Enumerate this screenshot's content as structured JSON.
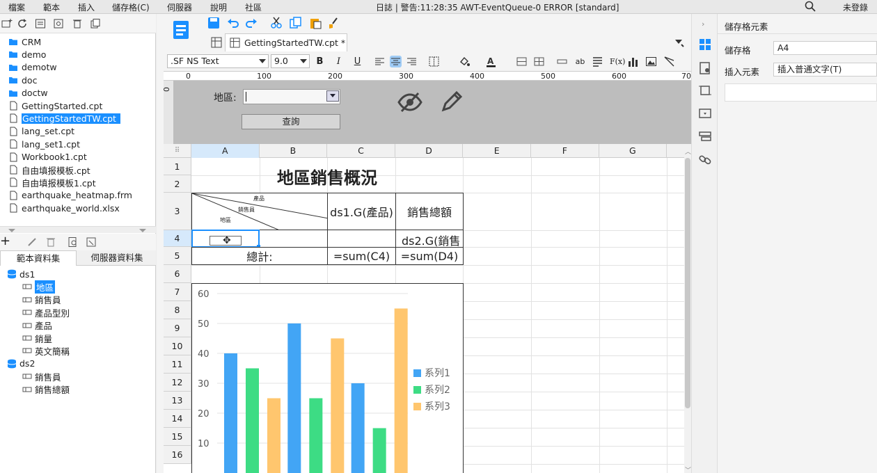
{
  "menubar": {
    "items": [
      "檔案",
      "範本",
      "插入",
      "儲存格(C)",
      "伺服器",
      "說明",
      "社區"
    ],
    "status": "日誌 | 警告:11:28:35 AWT-EventQueue-0 ERROR [standard]",
    "login": "未登錄"
  },
  "file_tree": {
    "items": [
      {
        "label": "CRM",
        "type": "folder"
      },
      {
        "label": "demo",
        "type": "folder"
      },
      {
        "label": "demotw",
        "type": "folder"
      },
      {
        "label": "doc",
        "type": "folder"
      },
      {
        "label": "doctw",
        "type": "folder"
      },
      {
        "label": "GettingStarted.cpt",
        "type": "file"
      },
      {
        "label": "GettingStartedTW.cpt",
        "type": "file",
        "selected": true
      },
      {
        "label": "lang_set.cpt",
        "type": "file"
      },
      {
        "label": "lang_set1.cpt",
        "type": "file"
      },
      {
        "label": "Workbook1.cpt",
        "type": "file"
      },
      {
        "label": "自由填报模板.cpt",
        "type": "file"
      },
      {
        "label": "自由填报模板1.cpt",
        "type": "file"
      },
      {
        "label": "earthquake_heatmap.frm",
        "type": "file"
      },
      {
        "label": "earthquake_world.xlsx",
        "type": "file"
      }
    ]
  },
  "dataset_tabs": [
    "範本資料集",
    "伺服器資料集"
  ],
  "dataset_tree": {
    "ds1": {
      "label": "ds1",
      "fields": [
        "地區",
        "銷售員",
        "產品型別",
        "產品",
        "銷量",
        "英文簡稱"
      ]
    },
    "ds2": {
      "label": "ds2",
      "fields": [
        "銷售員",
        "銷售總額"
      ]
    }
  },
  "editor": {
    "tab_label": "GettingStartedTW.cpt *",
    "font_name": ".SF NS Text",
    "font_size": "9.0",
    "bold": "B",
    "italic": "I",
    "underline": "U",
    "ruler_ticks": [
      "0",
      "100",
      "200",
      "300",
      "400",
      "500",
      "600",
      "70"
    ],
    "vruler_tick": "0"
  },
  "param_panel": {
    "label": "地區:",
    "query_button": "查詢"
  },
  "sheet": {
    "columns": [
      "A",
      "B",
      "C",
      "D",
      "E",
      "F",
      "G"
    ],
    "rows": [
      "1",
      "2",
      "3",
      "4",
      "5",
      "6",
      "7",
      "8",
      "9",
      "10",
      "11",
      "12",
      "13",
      "14",
      "15",
      "16"
    ],
    "title": "地區銷售概況",
    "diag_labels": {
      "product": "產品",
      "salesman": "銷售員",
      "region": "地區"
    },
    "c3": "ds1.G(產品)",
    "d3": "銷售總額",
    "d4": "ds2.G(銷售",
    "a5": "總計:",
    "c5": "=sum(C4)",
    "d5": "=sum(D4)"
  },
  "chart_data": {
    "type": "bar",
    "categories": [
      "",
      "",
      ""
    ],
    "series": [
      {
        "name": "系列1",
        "values": [
          40,
          50,
          30
        ],
        "color": "#42a5f5"
      },
      {
        "name": "系列2",
        "values": [
          35,
          25,
          15
        ],
        "color": "#3ddc84"
      },
      {
        "name": "系列3",
        "values": [
          25,
          45,
          55
        ],
        "color": "#ffc66e"
      }
    ],
    "yticks": [
      "10",
      "20",
      "30",
      "40",
      "50",
      "60"
    ],
    "ylim": [
      0,
      60
    ],
    "grid": true,
    "legend_position": "right"
  },
  "right_panel": {
    "header": "儲存格元素",
    "cell_label": "儲存格",
    "cell_value": "A4",
    "insert_label": "插入元素",
    "insert_value": "插入普通文字(T)"
  },
  "colors": {
    "accent": "#1a8fff",
    "folder": "#1a8fff",
    "db": "#1a8fff"
  }
}
